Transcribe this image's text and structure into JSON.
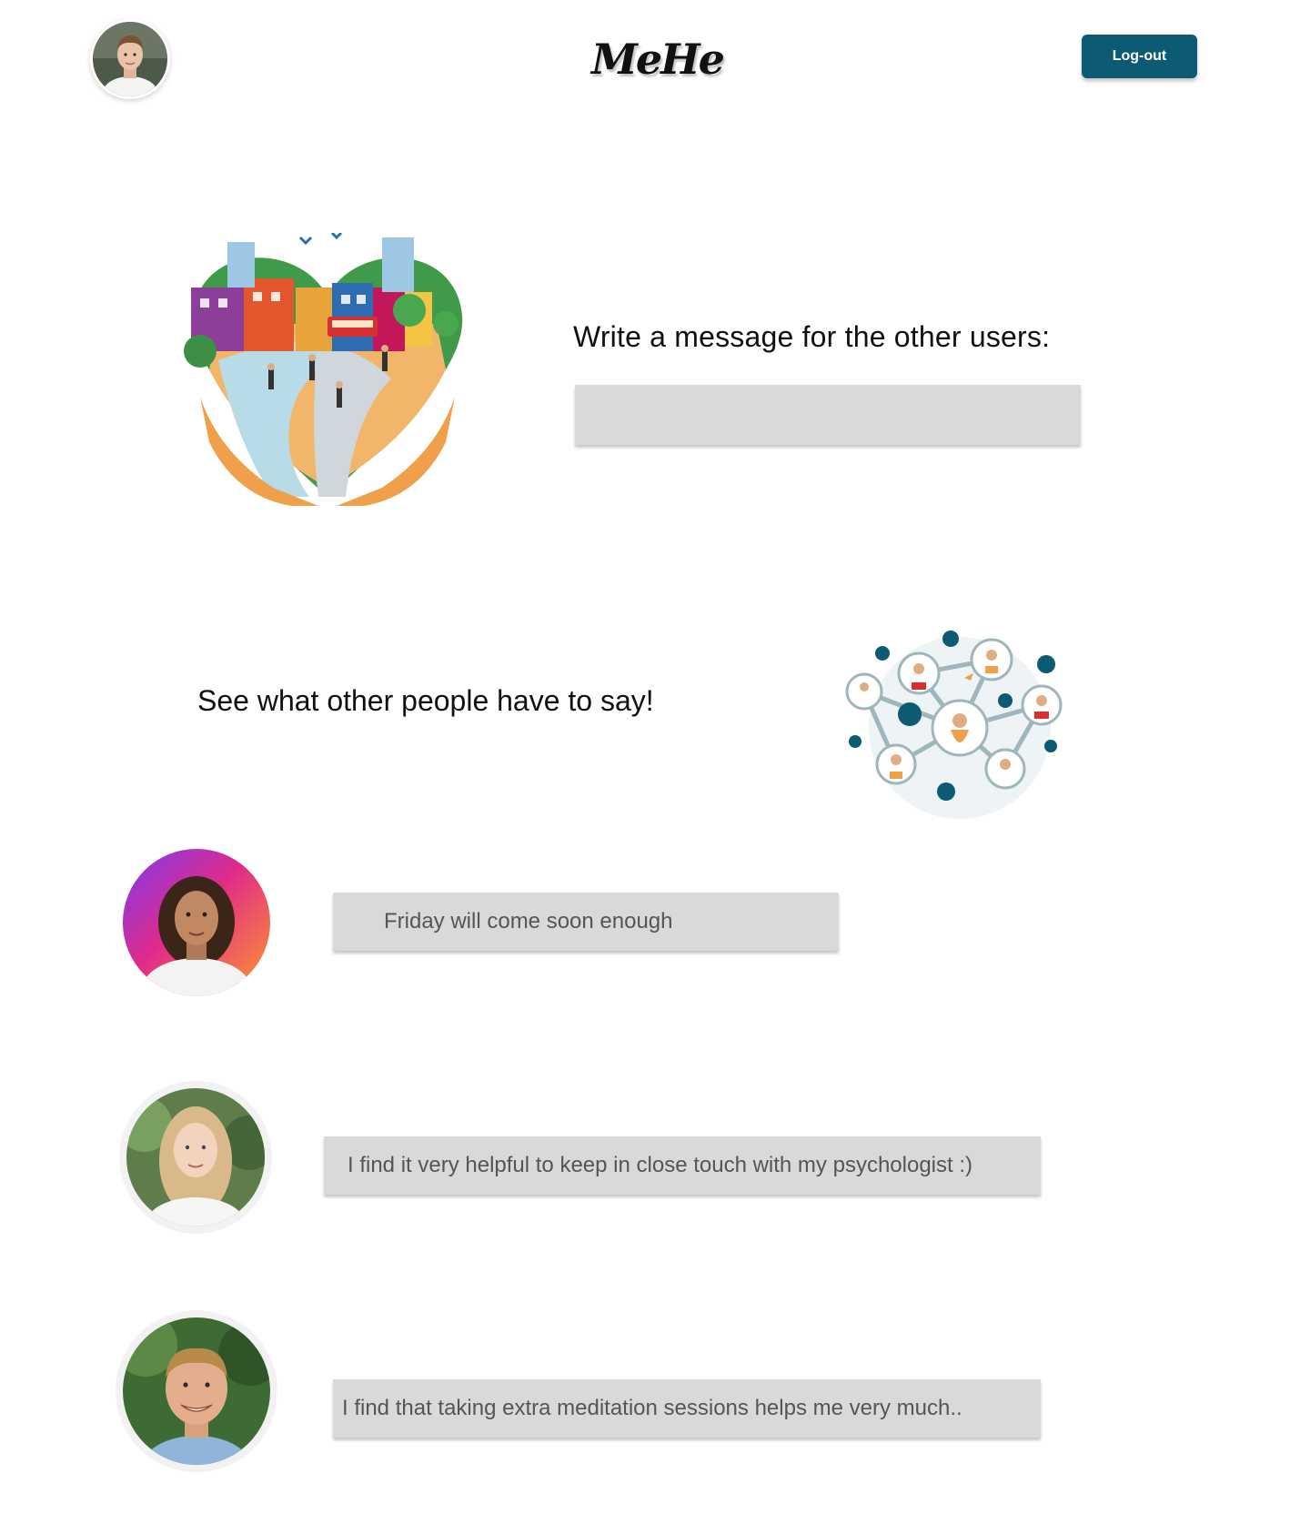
{
  "header": {
    "brand": "MeHe",
    "logout_label": "Log-out"
  },
  "compose": {
    "prompt": "Write a message for the other users:",
    "input_value": "",
    "input_placeholder": ""
  },
  "feed": {
    "heading": "See what other people have to say!",
    "messages": [
      {
        "text": "Friday will come soon enough"
      },
      {
        "text": "I find it very helpful to keep in close touch with my psychologist :)"
      },
      {
        "text": "I find that taking extra meditation sessions helps me very much.."
      }
    ]
  },
  "colors": {
    "accent": "#0d5a73",
    "message_bg": "#d9d9d9"
  }
}
